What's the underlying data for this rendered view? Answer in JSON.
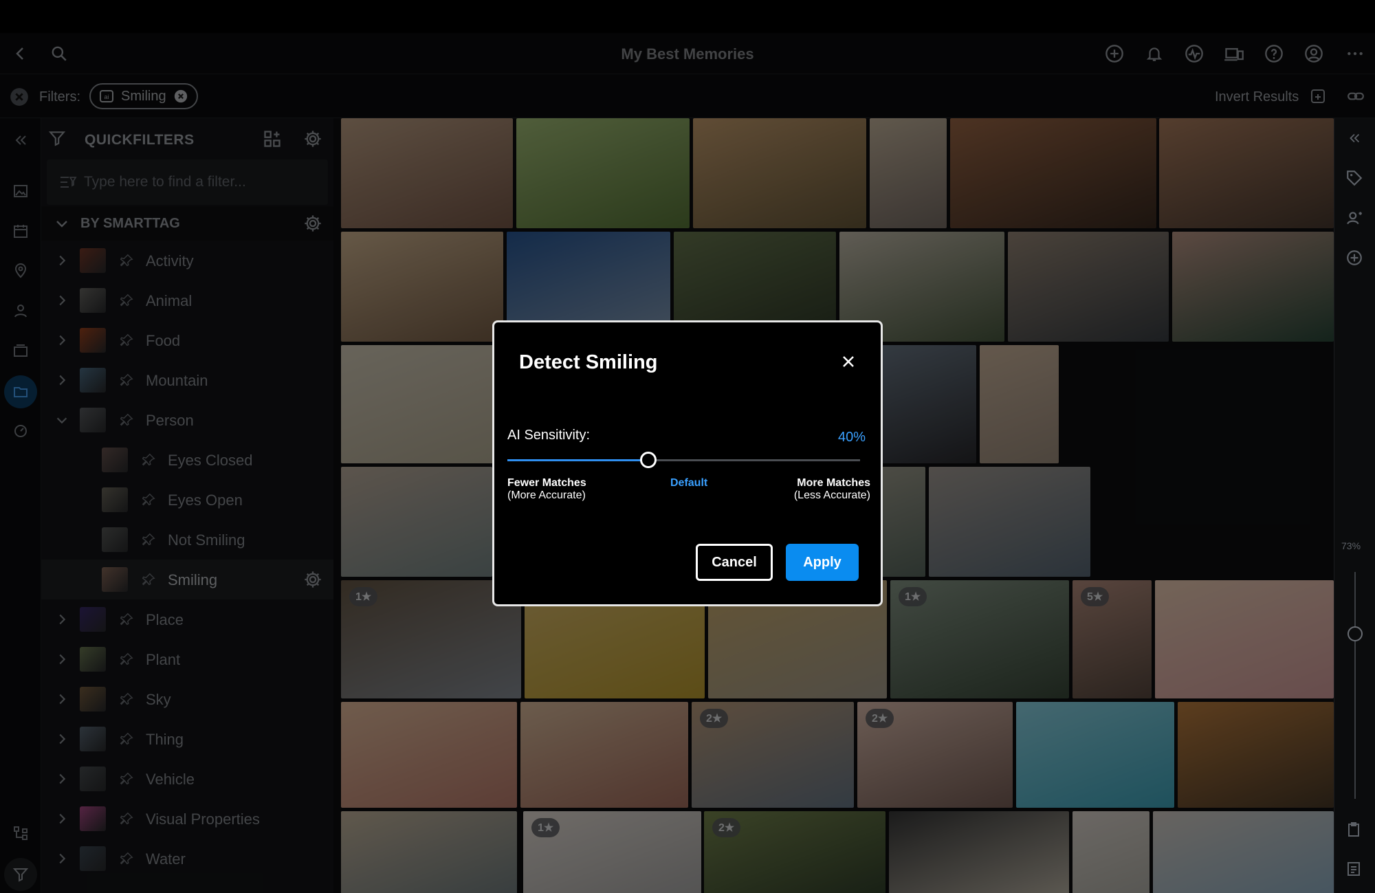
{
  "window": {
    "title": "My Best Memories"
  },
  "filters": {
    "label": "Filters:",
    "chip": "Smiling",
    "invert": "Invert Results"
  },
  "panel": {
    "header": "QUICKFILTERS",
    "search_placeholder": "Type here to find a filter...",
    "section": "BY SMARTTAG",
    "tags": [
      {
        "label": "Activity",
        "level": 0,
        "expanded": false
      },
      {
        "label": "Animal",
        "level": 0,
        "expanded": false
      },
      {
        "label": "Food",
        "level": 0,
        "expanded": false
      },
      {
        "label": "Mountain",
        "level": 0,
        "expanded": false
      },
      {
        "label": "Person",
        "level": 0,
        "expanded": true
      },
      {
        "label": "Eyes Closed",
        "level": 1
      },
      {
        "label": "Eyes Open",
        "level": 1
      },
      {
        "label": "Not Smiling",
        "level": 1
      },
      {
        "label": "Smiling",
        "level": 1,
        "active": true
      },
      {
        "label": "Place",
        "level": 0,
        "expanded": false
      },
      {
        "label": "Plant",
        "level": 0,
        "expanded": false
      },
      {
        "label": "Sky",
        "level": 0,
        "expanded": false
      },
      {
        "label": "Thing",
        "level": 0,
        "expanded": false
      },
      {
        "label": "Vehicle",
        "level": 0,
        "expanded": false
      },
      {
        "label": "Visual Properties",
        "level": 0,
        "expanded": false
      },
      {
        "label": "Water",
        "level": 0,
        "expanded": false
      }
    ]
  },
  "zoom": "73%",
  "badges": [
    "1★",
    "1★",
    "5★",
    "2★",
    "2★",
    "1★",
    "2★"
  ],
  "dialog": {
    "title": "Detect Smiling",
    "sensitivity_label": "AI Sensitivity:",
    "sensitivity_value": "40%",
    "sensitivity_fraction": 0.4,
    "left_label": "Fewer Matches",
    "left_sub": "(More Accurate)",
    "mid_label": "Default",
    "right_label": "More Matches",
    "right_sub": "(Less Accurate)",
    "cancel": "Cancel",
    "apply": "Apply"
  }
}
